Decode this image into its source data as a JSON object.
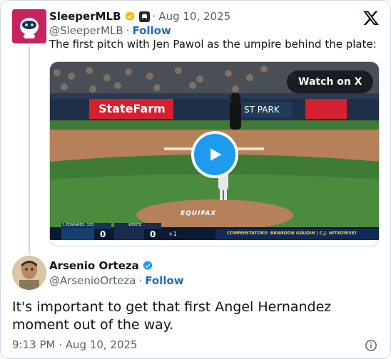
{
  "quoted": {
    "display_name": "SleeperMLB",
    "handle": "@SleeperMLB",
    "date": "Aug 10, 2025",
    "follow_label": "Follow",
    "text": "The first pitch with Jen Pawol as the umpire behind the plate:",
    "media": {
      "watch_label": "Watch on X",
      "banner_left": "StateFarm",
      "banner_right": "ST PARK",
      "scorebug": {
        "away_player": "1 EDWARDS .333",
        "home_player": "WENTZ",
        "away_score": "0",
        "home_score": "0",
        "count": "+1",
        "commentators": "COMMENTATORS: BRANDON GAUDIN | C.J. NITKOWSKI"
      },
      "mound_text": "EQUIFAX"
    }
  },
  "reply": {
    "display_name": "Arsenio Orteza",
    "handle": "@ArsenioOrteza",
    "follow_label": "Follow",
    "text": "It's important to get that first Angel Hernandez moment out of the way.",
    "timestamp": "9:13 PM · Aug 10, 2025"
  },
  "colors": {
    "verified": "#f0b90b",
    "verified_blue": "#1d9bf0",
    "link": "#1d6ec2",
    "avatar_bg": "#c8235f"
  },
  "icons": [
    "x-logo-icon",
    "verified-badge-icon",
    "info-icon",
    "play-icon"
  ]
}
